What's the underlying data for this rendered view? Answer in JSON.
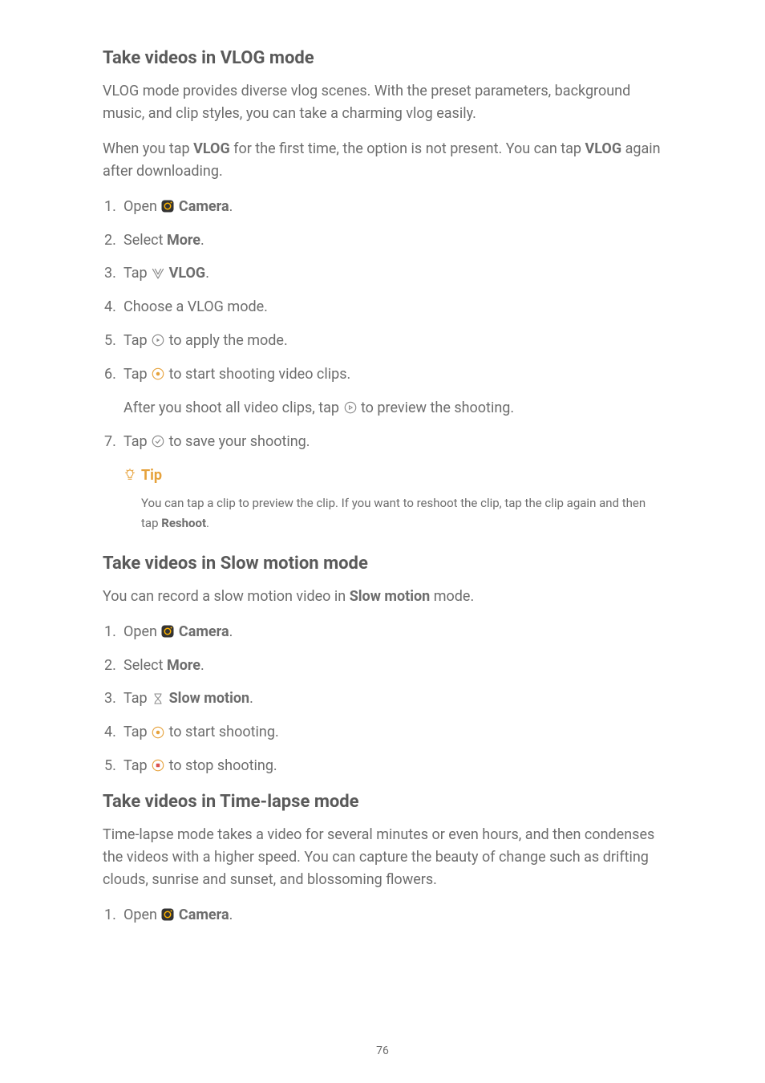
{
  "section1": {
    "heading": "Take videos in VLOG mode",
    "p1a": "VLOG mode provides diverse vlog scenes. With the preset parameters, back",
    "p1b": "ground music, and clip styles, you can take a charming vlog easily.",
    "p2a": "When you tap ",
    "p2b": " for the first time, the option is not present. You can tap ",
    "p2c": " again after downloading.",
    "vlog_bold": "VLOG",
    "steps": {
      "s1_open": "Open ",
      "s1_camera": "Camera",
      "s1_dot": ".",
      "s2_select": "Select ",
      "s2_more": "More",
      "s2_dot": ".",
      "s3_tap": "Tap ",
      "s3_vlog": "VLOG",
      "s3_dot": ".",
      "s4": "Choose a VLOG mode.",
      "s5_tap": "Tap ",
      "s5_rest": " to apply the mode.",
      "s6_tap": "Tap ",
      "s6_rest": " to start shooting video clips.",
      "s6_sub_a": "After you shoot all video clips, tap ",
      "s6_sub_b": " to preview the shooting.",
      "s7_tap": "Tap ",
      "s7_rest": " to save your shooting."
    },
    "tip": {
      "label": "Tip",
      "body_a": "You can tap a clip to preview the clip. If you want to reshoot the clip, tap the clip again and then tap ",
      "body_bold": "Reshoot",
      "body_c": "."
    }
  },
  "section2": {
    "heading": "Take videos in Slow motion mode",
    "p1a": "You can record a slow motion video in ",
    "p1_bold": "Slow motion",
    "p1b": " mode.",
    "steps": {
      "s1_open": "Open ",
      "s1_camera": "Camera",
      "s1_dot": ".",
      "s2_select": "Select ",
      "s2_more": "More",
      "s2_dot": ".",
      "s3_tap": "Tap ",
      "s3_bold": "Slow motion",
      "s3_dot": ".",
      "s4_tap": "Tap ",
      "s4_rest": " to start shooting.",
      "s5_tap": "Tap ",
      "s5_rest": " to stop shooting."
    }
  },
  "section3": {
    "heading": "Take videos in Time-lapse mode",
    "p1a": "Time-lapse mode takes a video for several minutes or even hours, and then con",
    "p1b": "denses the videos with a higher speed. You can capture the beauty of change such as drifting clouds, sunrise and sunset, and blossoming flowers.",
    "steps": {
      "s1_open": "Open ",
      "s1_camera": "Camera",
      "s1_dot": "."
    }
  },
  "page_number": "76"
}
